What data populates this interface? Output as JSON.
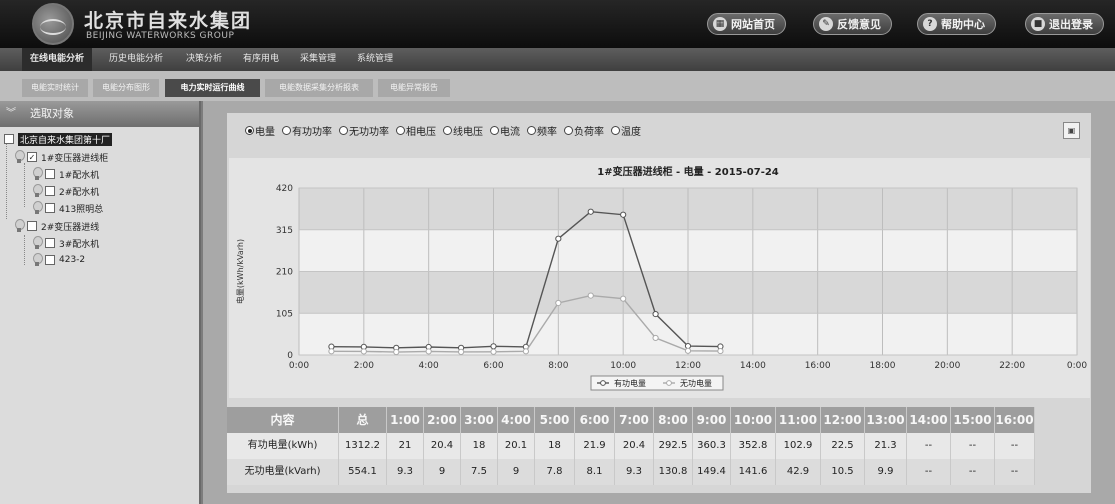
{
  "header": {
    "brand_cn": "北京市自来水集团",
    "brand_en": "BEIJING WATERWORKS GROUP",
    "buttons": [
      {
        "label": "网站首页",
        "icon": "grid-icon"
      },
      {
        "label": "反馈意见",
        "icon": "chat-icon"
      },
      {
        "label": "帮助中心",
        "icon": "help-icon"
      },
      {
        "label": "退出登录",
        "icon": "lock-icon"
      }
    ]
  },
  "nav_main": [
    "在线电能分析",
    "历史电能分析",
    "决策分析",
    "有序用电",
    "采集管理",
    "系统管理"
  ],
  "nav_sub": [
    "电能实时统计",
    "电能分布图形",
    "电力实时运行曲线",
    "电能数据采集分析报表",
    "电能异常报告"
  ],
  "sidebar": {
    "title": "选取对象",
    "tree": [
      {
        "label": "北京自来水集团第十厂",
        "checked": false
      },
      {
        "label": "1#变压器进线柜",
        "checked": true
      },
      {
        "label": "1#配水机",
        "checked": false
      },
      {
        "label": "2#配水机",
        "checked": false
      },
      {
        "label": "413照明总",
        "checked": false
      },
      {
        "label": "2#变压器进线",
        "checked": false
      },
      {
        "label": "3#配水机",
        "checked": false
      },
      {
        "label": "423-2",
        "checked": false
      }
    ]
  },
  "radios": [
    {
      "label": "电量",
      "selected": true
    },
    {
      "label": "有功功率",
      "selected": false
    },
    {
      "label": "无功功率",
      "selected": false
    },
    {
      "label": "相电压",
      "selected": false
    },
    {
      "label": "线电压",
      "selected": false
    },
    {
      "label": "电流",
      "selected": false
    },
    {
      "label": "频率",
      "selected": false
    },
    {
      "label": "负荷率",
      "selected": false
    },
    {
      "label": "温度",
      "selected": false
    }
  ],
  "export_icon": "image-export-icon",
  "chart_data": {
    "type": "line",
    "title": "1#变压器进线柜 - 电量 - 2015-07-24",
    "ylabel": "电量(kWh/kVarh)",
    "ylim": [
      0,
      420
    ],
    "yticks": [
      0,
      105,
      210,
      315,
      420
    ],
    "xticks": [
      "0:00",
      "2:00",
      "4:00",
      "6:00",
      "8:00",
      "10:00",
      "12:00",
      "14:00",
      "16:00",
      "18:00",
      "20:00",
      "22:00",
      "0:00"
    ],
    "x": [
      1,
      2,
      3,
      4,
      5,
      6,
      7,
      8,
      9,
      10,
      11,
      12,
      13
    ],
    "series": [
      {
        "name": "有功电量",
        "color": "#555555",
        "values": [
          21,
          20.4,
          18,
          20.1,
          18,
          21.9,
          20.4,
          292.5,
          360.3,
          352.8,
          102.9,
          22.5,
          21.3
        ]
      },
      {
        "name": "无功电量",
        "color": "#aaaaaa",
        "values": [
          9.3,
          9,
          7.5,
          9,
          7.8,
          8.1,
          9.3,
          130.8,
          149.4,
          141.6,
          42.9,
          10.5,
          9.9
        ]
      }
    ],
    "legend_position": "bottom",
    "grid": true
  },
  "table": {
    "headers": [
      "内容",
      "总",
      "1:00",
      "2:00",
      "3:00",
      "4:00",
      "5:00",
      "6:00",
      "7:00",
      "8:00",
      "9:00",
      "10:00",
      "11:00",
      "12:00",
      "13:00",
      "14:00",
      "15:00",
      "16:00"
    ],
    "rows": [
      [
        "有功电量(kWh)",
        "1312.2",
        "21",
        "20.4",
        "18",
        "20.1",
        "18",
        "21.9",
        "20.4",
        "292.5",
        "360.3",
        "352.8",
        "102.9",
        "22.5",
        "21.3",
        "--",
        "--",
        "--"
      ],
      [
        "无功电量(kVarh)",
        "554.1",
        "9.3",
        "9",
        "7.5",
        "9",
        "7.8",
        "8.1",
        "9.3",
        "130.8",
        "149.4",
        "141.6",
        "42.9",
        "10.5",
        "9.9",
        "--",
        "--",
        "--"
      ]
    ]
  }
}
